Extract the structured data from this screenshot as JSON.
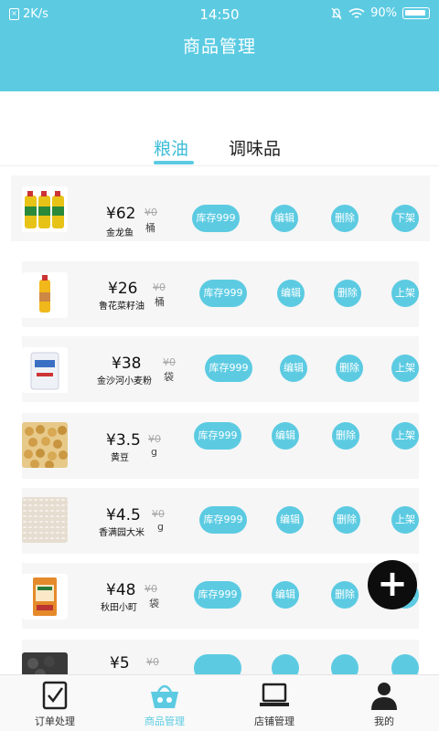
{
  "status_bar": {
    "net_speed": "2K/s",
    "time": "14:50",
    "battery": "90%"
  },
  "header": {
    "title": "商品管理"
  },
  "tabs": [
    {
      "label": "粮油",
      "active": true
    },
    {
      "label": "调味品",
      "active": false
    }
  ],
  "products": [
    {
      "price": "¥62",
      "old_price": "¥0",
      "name": "金龙鱼",
      "unit": "桶",
      "stock_label": "库存999",
      "edit_label": "编辑",
      "delete_label": "删除",
      "status_label": "下架"
    },
    {
      "price": "¥26",
      "old_price": "¥0",
      "name": "鲁花菜籽油",
      "unit": "桶",
      "stock_label": "库存999",
      "edit_label": "编辑",
      "delete_label": "删除",
      "status_label": "上架"
    },
    {
      "price": "¥38",
      "old_price": "¥0",
      "name": "金沙河小麦粉",
      "unit": "袋",
      "stock_label": "库存999",
      "edit_label": "编辑",
      "delete_label": "删除",
      "status_label": "上架"
    },
    {
      "price": "¥3.5",
      "old_price": "¥0",
      "name": "黄豆",
      "unit": "g",
      "stock_label": "库存999",
      "edit_label": "编辑",
      "delete_label": "删除",
      "status_label": "上架"
    },
    {
      "price": "¥4.5",
      "old_price": "¥0",
      "name": "香满园大米",
      "unit": "g",
      "stock_label": "库存999",
      "edit_label": "编辑",
      "delete_label": "删除",
      "status_label": "上架"
    },
    {
      "price": "¥48",
      "old_price": "¥0",
      "name": "秋田小町",
      "unit": "袋",
      "stock_label": "库存999",
      "edit_label": "编辑",
      "delete_label": "删除",
      "status_label": "上架"
    },
    {
      "price": "¥5",
      "old_price": "¥0"
    }
  ],
  "fab": {
    "symbol": "+"
  },
  "bottom_nav": [
    {
      "label": "订单处理",
      "icon": "order-check-icon",
      "active": false
    },
    {
      "label": "商品管理",
      "icon": "basket-icon",
      "active": true
    },
    {
      "label": "店铺管理",
      "icon": "laptop-icon",
      "active": false
    },
    {
      "label": "我的",
      "icon": "person-icon",
      "active": false
    }
  ],
  "colors": {
    "accent": "#5ccbe2",
    "row_bg": "#f6f6f6",
    "fab_bg": "#0d0d0d"
  }
}
